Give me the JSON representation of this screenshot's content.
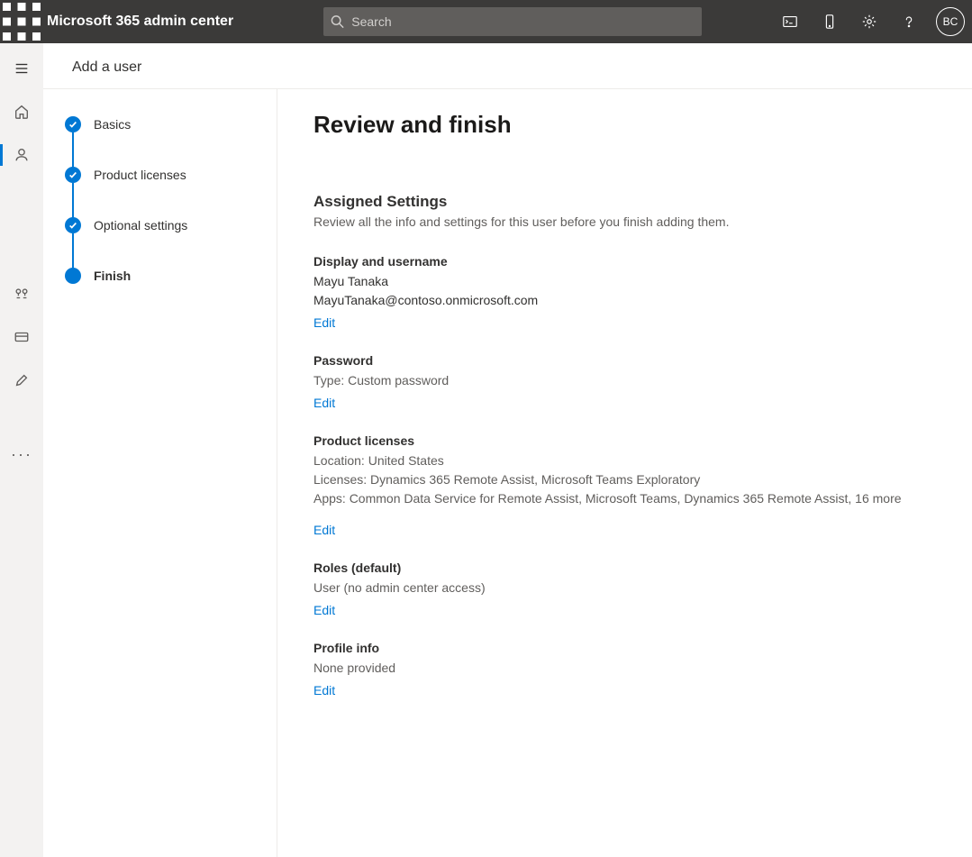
{
  "header": {
    "app_title": "Microsoft 365 admin center",
    "search_placeholder": "Search",
    "avatar_initials": "BC"
  },
  "panel": {
    "title": "Add a user"
  },
  "stepper": {
    "steps": [
      {
        "label": "Basics",
        "state": "done"
      },
      {
        "label": "Product licenses",
        "state": "done"
      },
      {
        "label": "Optional settings",
        "state": "done"
      },
      {
        "label": "Finish",
        "state": "current"
      }
    ]
  },
  "content": {
    "heading": "Review and finish",
    "assigned_label": "Assigned Settings",
    "assigned_desc": "Review all the info and settings for this user before you finish adding them.",
    "edit_label": "Edit",
    "display_username": {
      "label": "Display and username",
      "name": "Mayu Tanaka",
      "email": "MayuTanaka@contoso.onmicrosoft.com"
    },
    "password": {
      "label": "Password",
      "type_line": "Type: Custom password"
    },
    "licenses": {
      "label": "Product licenses",
      "location_line": "Location: United States",
      "licenses_line": "Licenses: Dynamics 365 Remote Assist, Microsoft Teams Exploratory",
      "apps_line": "Apps: Common Data Service for Remote Assist, Microsoft Teams, Dynamics 365 Remote Assist, 16 more"
    },
    "roles": {
      "label": "Roles (default)",
      "value": "User (no admin center access)"
    },
    "profile": {
      "label": "Profile info",
      "value": "None provided"
    }
  }
}
